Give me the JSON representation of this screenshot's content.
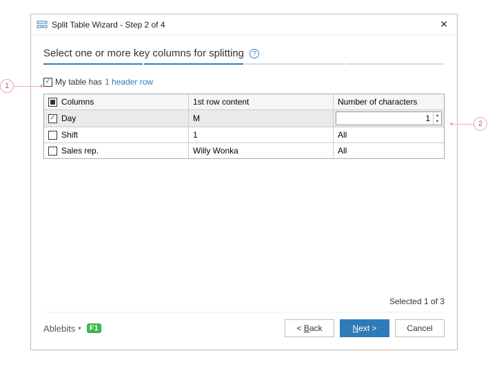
{
  "titlebar": {
    "title": "Split Table Wizard - Step 2 of 4"
  },
  "heading": "Select one or more key columns for splitting",
  "header_row": {
    "prefix": "My table has",
    "link": "1 header row"
  },
  "table": {
    "headers": {
      "col1": "Columns",
      "col2": "1st row content",
      "col3": "Number of characters"
    },
    "rows": [
      {
        "checked": true,
        "name": "Day",
        "sample": "M",
        "chars": "1"
      },
      {
        "checked": false,
        "name": "Shift",
        "sample": "1",
        "chars": "All"
      },
      {
        "checked": false,
        "name": "Sales rep.",
        "sample": "Willy Wonka",
        "chars": "All"
      }
    ]
  },
  "status": "Selected 1 of 3",
  "footer": {
    "brand": "Ablebits",
    "f1": "F1",
    "back": "< Back",
    "next": "Next >",
    "cancel": "Cancel"
  },
  "callouts": {
    "c1": "1",
    "c2": "2"
  }
}
